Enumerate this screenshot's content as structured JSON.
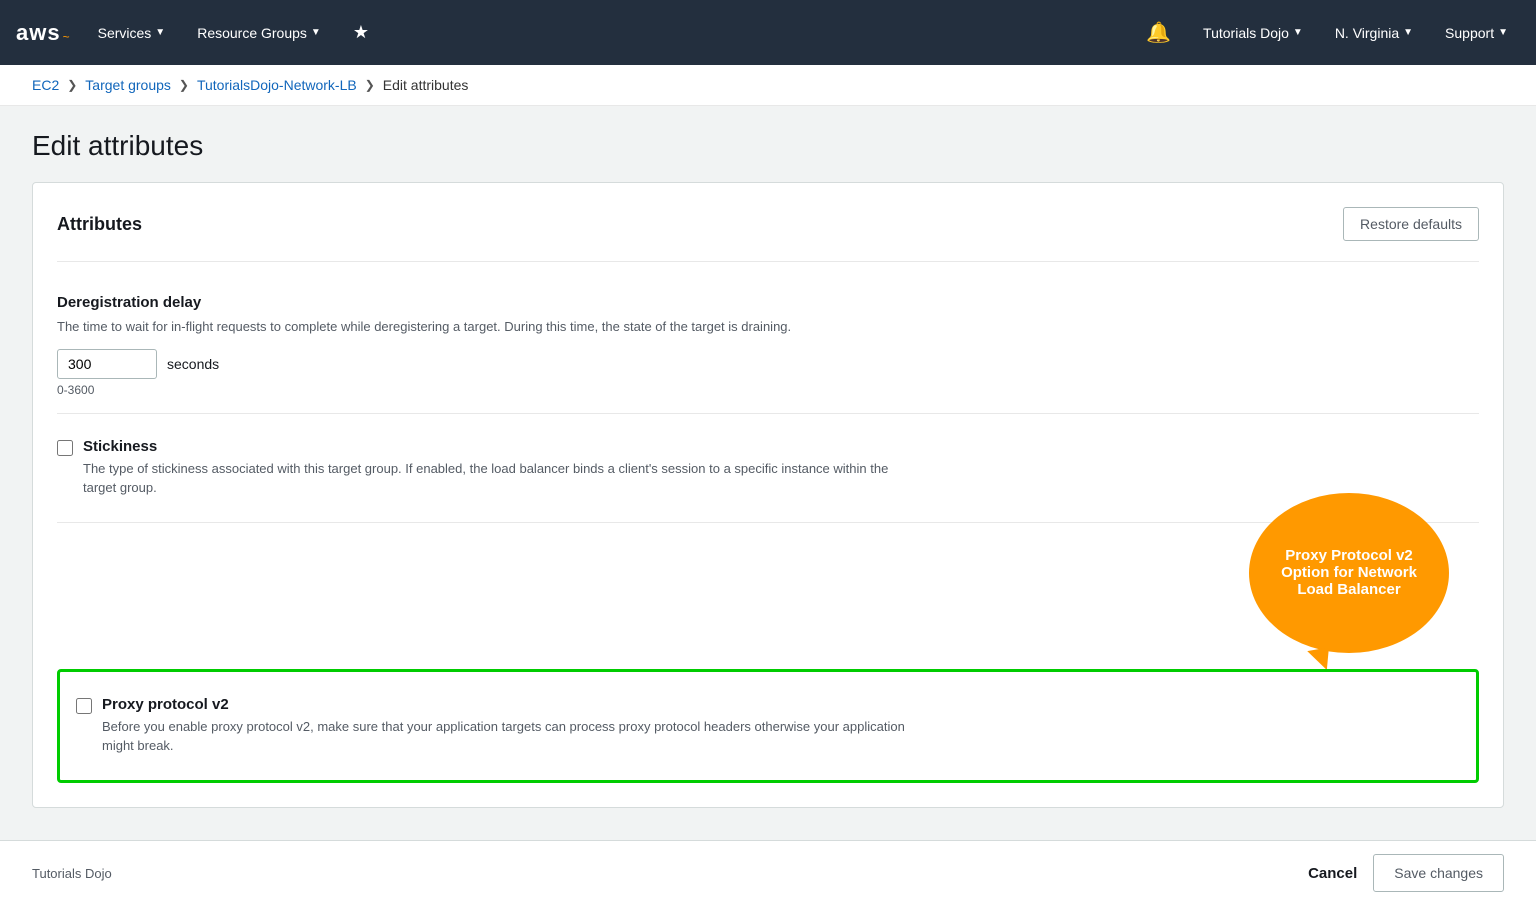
{
  "nav": {
    "logo": "aws",
    "logo_smile": "~",
    "services_label": "Services",
    "resource_groups_label": "Resource Groups",
    "tutorials_dojo_label": "Tutorials Dojo",
    "region_label": "N. Virginia",
    "support_label": "Support"
  },
  "breadcrumb": {
    "items": [
      {
        "label": "EC2",
        "link": true
      },
      {
        "label": "Target groups",
        "link": true
      },
      {
        "label": "TutorialsDojo-Network-LB",
        "link": true
      },
      {
        "label": "Edit attributes",
        "link": false
      }
    ]
  },
  "page": {
    "title": "Edit attributes"
  },
  "card": {
    "title": "Attributes",
    "restore_defaults_label": "Restore defaults",
    "deregistration": {
      "title": "Deregistration delay",
      "description": "The time to wait for in-flight requests to complete while deregistering a target. During this time, the state of the target is draining.",
      "value": "300",
      "unit": "seconds",
      "range": "0-3600"
    },
    "stickiness": {
      "title": "Stickiness",
      "description": "The type of stickiness associated with this target group. If enabled, the load balancer binds a client's session to a specific instance within the target group.",
      "checked": false
    },
    "proxy_protocol": {
      "title": "Proxy protocol v2",
      "description": "Before you enable proxy protocol v2, make sure that your application targets can process proxy protocol headers otherwise your application might break.",
      "checked": false
    }
  },
  "callout": {
    "text": "Proxy Protocol v2 Option for Network Load Balancer"
  },
  "footer": {
    "brand": "Tutorials Dojo",
    "cancel_label": "Cancel",
    "save_label": "Save changes"
  }
}
